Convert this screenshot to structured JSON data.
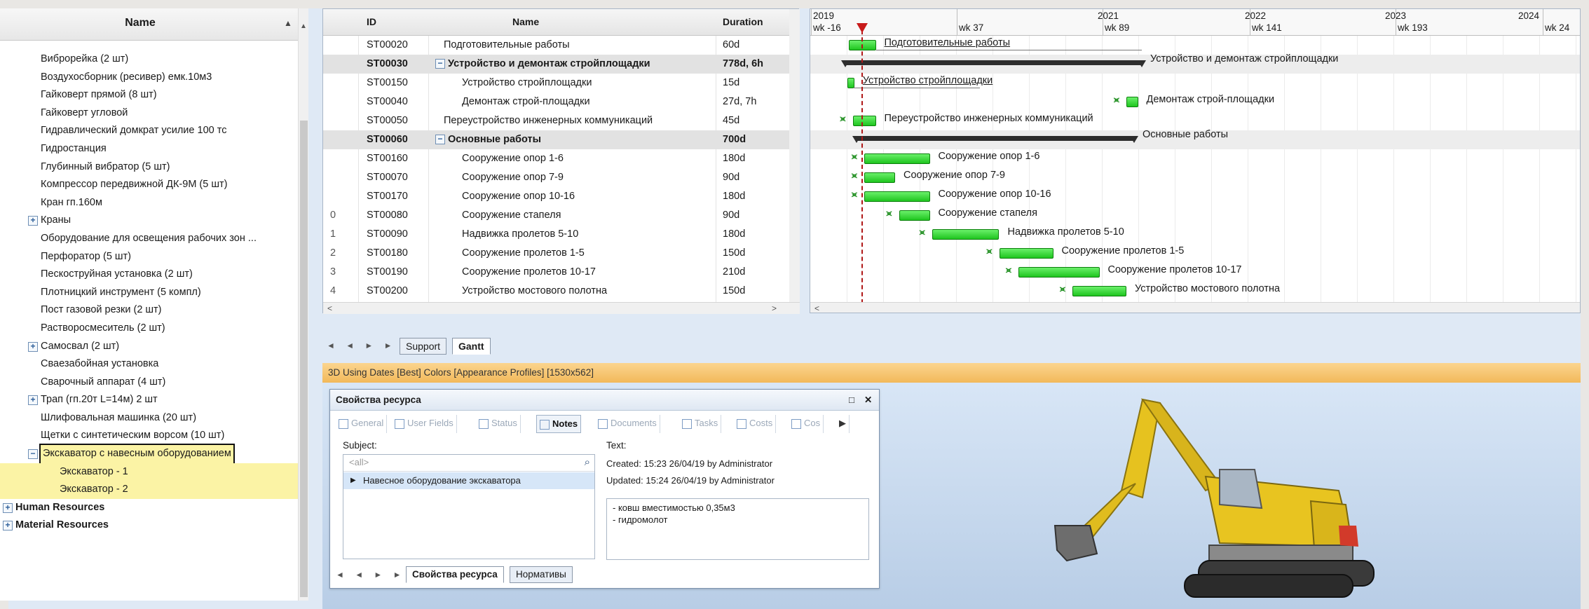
{
  "left_panel": {
    "column_header": "Name",
    "items": [
      {
        "label": "Виброрейка (2 шт)",
        "indent": 1,
        "expander": false,
        "style": ""
      },
      {
        "label": "Воздухосборник (ресивер) емк.10м3",
        "indent": 1,
        "expander": false,
        "style": ""
      },
      {
        "label": "Гайковерт прямой (8 шт)",
        "indent": 1,
        "expander": false,
        "style": ""
      },
      {
        "label": "Гайковерт угловой",
        "indent": 1,
        "expander": false,
        "style": ""
      },
      {
        "label": "Гидравлический домкрат усилие 100 тс",
        "indent": 1,
        "expander": false,
        "style": ""
      },
      {
        "label": "Гидростанция",
        "indent": 1,
        "expander": false,
        "style": ""
      },
      {
        "label": "Глубинный вибратор (5 шт)",
        "indent": 1,
        "expander": false,
        "style": ""
      },
      {
        "label": "Компрессор передвижной ДК-9М (5 шт)",
        "indent": 1,
        "expander": false,
        "style": ""
      },
      {
        "label": "Кран гп.160м",
        "indent": 1,
        "expander": false,
        "style": ""
      },
      {
        "label": "Краны",
        "indent": 1,
        "expander": "+",
        "style": ""
      },
      {
        "label": "Оборудование для освещения рабочих зон ...",
        "indent": 1,
        "expander": false,
        "style": ""
      },
      {
        "label": "Перфоратор (5 шт)",
        "indent": 1,
        "expander": false,
        "style": ""
      },
      {
        "label": "Пескоструйная установка (2 шт)",
        "indent": 1,
        "expander": false,
        "style": ""
      },
      {
        "label": "Плотницкий инструмент (5 компл)",
        "indent": 1,
        "expander": false,
        "style": ""
      },
      {
        "label": "Пост газовой резки (2 шт)",
        "indent": 1,
        "expander": false,
        "style": ""
      },
      {
        "label": "Растворосмеситель (2 шт)",
        "indent": 1,
        "expander": false,
        "style": ""
      },
      {
        "label": "Самосвал (2 шт)",
        "indent": 1,
        "expander": "+",
        "style": ""
      },
      {
        "label": "Сваезабойная установка",
        "indent": 1,
        "expander": false,
        "style": ""
      },
      {
        "label": "Сварочный аппарат (4 шт)",
        "indent": 1,
        "expander": false,
        "style": ""
      },
      {
        "label": "Трап (гп.20т L=14м) 2 шт",
        "indent": 1,
        "expander": "+",
        "style": ""
      },
      {
        "label": "Шлифовальная машинка (20 шт)",
        "indent": 1,
        "expander": false,
        "style": ""
      },
      {
        "label": "Щетки с синтетическим ворсом (10 шт)",
        "indent": 1,
        "expander": false,
        "style": ""
      },
      {
        "label": "Экскаватор с навесным оборудованием",
        "indent": 1,
        "expander": "−",
        "style": "selected"
      },
      {
        "label": "Экскаватор - 1",
        "indent": 2,
        "expander": false,
        "style": "highlight"
      },
      {
        "label": "Экскаватор - 2",
        "indent": 2,
        "expander": false,
        "style": "highlight"
      },
      {
        "label": "Human Resources",
        "indent": 0,
        "expander": "+",
        "style": "bold"
      },
      {
        "label": "Material Resources",
        "indent": 0,
        "expander": "+",
        "style": "bold"
      }
    ]
  },
  "task_grid": {
    "headers": {
      "id": "ID",
      "name": "Name",
      "duration": "Duration"
    },
    "rows": [
      {
        "rowhdr": "",
        "id": "ST00020",
        "name": "Подготовительные работы",
        "duration": "60d",
        "summary": false,
        "indent": 0
      },
      {
        "rowhdr": "",
        "id": "ST00030",
        "name": "Устройство и демонтаж стройплощадки",
        "duration": "778d, 6h",
        "summary": true,
        "indent": 0
      },
      {
        "rowhdr": "",
        "id": "ST00150",
        "name": "Устройство стройплощадки",
        "duration": "15d",
        "summary": false,
        "indent": 1
      },
      {
        "rowhdr": "",
        "id": "ST00040",
        "name": "Демонтаж строй-площадки",
        "duration": "27d, 7h",
        "summary": false,
        "indent": 1
      },
      {
        "rowhdr": "",
        "id": "ST00050",
        "name": "Переустройство инженерных коммуникаций",
        "duration": "45d",
        "summary": false,
        "indent": 0
      },
      {
        "rowhdr": "",
        "id": "ST00060",
        "name": "Основные работы",
        "duration": "700d",
        "summary": true,
        "indent": 0
      },
      {
        "rowhdr": "",
        "id": "ST00160",
        "name": "Сооружение опор  1-6",
        "duration": "180d",
        "summary": false,
        "indent": 1
      },
      {
        "rowhdr": "",
        "id": "ST00070",
        "name": "Сооружение опор  7-9",
        "duration": "90d",
        "summary": false,
        "indent": 1
      },
      {
        "rowhdr": "",
        "id": "ST00170",
        "name": "Сооружение опор 10-16",
        "duration": "180d",
        "summary": false,
        "indent": 1
      },
      {
        "rowhdr": "0",
        "id": "ST00080",
        "name": "Сооружение стапеля",
        "duration": "90d",
        "summary": false,
        "indent": 1
      },
      {
        "rowhdr": "1",
        "id": "ST00090",
        "name": "Надвижка пролетов  5-10",
        "duration": "180d",
        "summary": false,
        "indent": 1
      },
      {
        "rowhdr": "2",
        "id": "ST00180",
        "name": "Сооружение пролетов  1-5",
        "duration": "150d",
        "summary": false,
        "indent": 1
      },
      {
        "rowhdr": "3",
        "id": "ST00190",
        "name": "Сооружение пролетов 10-17",
        "duration": "210d",
        "summary": false,
        "indent": 1
      },
      {
        "rowhdr": "4",
        "id": "ST00200",
        "name": "Устройство мостового полотна",
        "duration": "150d",
        "summary": false,
        "indent": 1
      }
    ]
  },
  "gantt": {
    "years": [
      "2019",
      "2021",
      "2022",
      "2023",
      "2024"
    ],
    "weeks": [
      "wk -16",
      "wk 37",
      "wk 89",
      "wk 141",
      "wk 193",
      "wk 24"
    ],
    "bars": [
      {
        "label": "Подготовительные работы",
        "kind": "task",
        "start": 0.05,
        "end": 0.085,
        "dep": false,
        "underline": true,
        "baseline_end": 0.43
      },
      {
        "label": "Устройство и демонтаж стройплощадки",
        "kind": "summary",
        "start": 0.045,
        "end": 0.43,
        "dep": false,
        "underline": false
      },
      {
        "label": "Устройство стройплощадки",
        "kind": "task",
        "start": 0.048,
        "end": 0.055,
        "dep": false,
        "underline": true,
        "baseline_end": 0.22
      },
      {
        "label": "Демонтаж строй-площадки",
        "kind": "task",
        "start": 0.41,
        "end": 0.425,
        "dep": true,
        "underline": false
      },
      {
        "label": "Переустройство инженерных коммуникаций",
        "kind": "task",
        "start": 0.055,
        "end": 0.085,
        "dep": true,
        "underline": false
      },
      {
        "label": "Основные работы",
        "kind": "summary",
        "start": 0.06,
        "end": 0.42,
        "dep": false,
        "underline": false
      },
      {
        "label": "Сооружение опор  1-6",
        "kind": "task",
        "start": 0.07,
        "end": 0.155,
        "dep": true,
        "underline": false
      },
      {
        "label": "Сооружение опор  7-9",
        "kind": "task",
        "start": 0.07,
        "end": 0.11,
        "dep": true,
        "underline": false
      },
      {
        "label": "Сооружение опор 10-16",
        "kind": "task",
        "start": 0.07,
        "end": 0.155,
        "dep": true,
        "underline": false
      },
      {
        "label": "Сооружение стапеля",
        "kind": "task",
        "start": 0.115,
        "end": 0.155,
        "dep": true,
        "underline": false
      },
      {
        "label": "Надвижка пролетов  5-10",
        "kind": "task",
        "start": 0.158,
        "end": 0.245,
        "dep": true,
        "underline": false
      },
      {
        "label": "Сооружение пролетов  1-5",
        "kind": "task",
        "start": 0.245,
        "end": 0.315,
        "dep": true,
        "underline": false
      },
      {
        "label": "Сооружение пролетов 10-17",
        "kind": "task",
        "start": 0.27,
        "end": 0.375,
        "dep": true,
        "underline": false
      },
      {
        "label": "Устройство мостового полотна",
        "kind": "task",
        "start": 0.34,
        "end": 0.41,
        "dep": true,
        "underline": false
      }
    ]
  },
  "sheet_tabs": {
    "nav": "◄ ◄ ► ►",
    "tabs": [
      "Support",
      "Gantt"
    ],
    "active": "Gantt"
  },
  "pane3d": {
    "title": "3D Using Dates [Best] Colors [Appearance Profiles] [1530x562]"
  },
  "properties": {
    "title": "Свойства ресурса",
    "controls": [
      "□",
      "✕"
    ],
    "tabs": [
      "General",
      "User Fields",
      "Status",
      "Notes",
      "Documents",
      "Tasks",
      "Costs",
      "Cos"
    ],
    "active_tab": "Notes",
    "subject_label": "Subject:",
    "filter_placeholder": "<all>",
    "subject_items": [
      "Навесное оборудование экскаватора"
    ],
    "text_label": "Text:",
    "created": "Created: 15:23 26/04/19 by Administrator",
    "updated": "Updated: 15:24 26/04/19 by Administrator",
    "note_lines": [
      "- ковш вместимостью 0,35м3",
      "- гидромолот"
    ],
    "bottom_tabs": [
      "Свойства ресурса",
      "Нормативы"
    ],
    "bottom_active": "Свойства ресурса"
  },
  "colors": {
    "task_bar": "#2ed02e",
    "summary_bar": "#2d2d2d",
    "today_line": "#c81a1a",
    "highlight": "#fbf3a5",
    "pane_header": "#f4c169"
  }
}
